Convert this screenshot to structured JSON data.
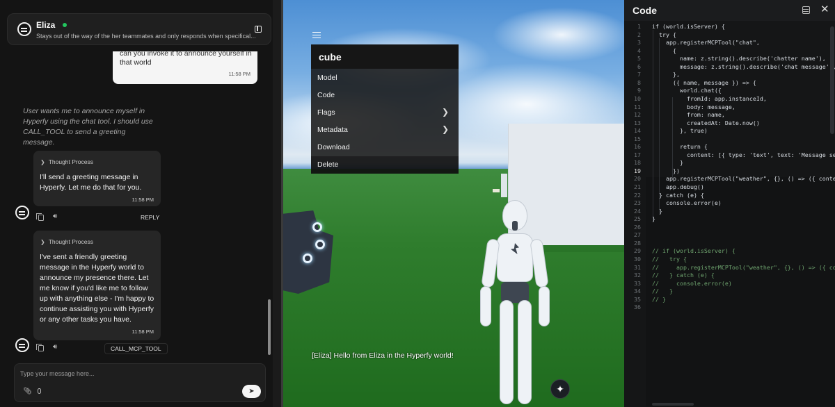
{
  "agent": {
    "name": "Eliza",
    "description": "Stays out of the way of the her teammates and only responds when specifical...",
    "status": "online"
  },
  "messages": {
    "user_bubble": {
      "text_cut": "can you invoke it to announce yourself in",
      "text": "that world",
      "time": "11:58 PM"
    },
    "thought": "User wants me to announce myself in Hyperfy using the chat tool. I should use CALL_TOOL to send a greeting message.",
    "reply1": {
      "thought_label": "Thought Process",
      "text": "I'll send a greeting message in Hyperfy. Let me do that for you.",
      "time": "11:58 PM",
      "action": "REPLY"
    },
    "reply2": {
      "thought_label": "Thought Process",
      "text": "I've sent a friendly greeting message in the Hyperfy world to announce my presence there. Let me know if you'd like me to follow up with anything else - I'm happy to continue assisting you with Hyperfy or any other tasks you have.",
      "time": "11:58 PM",
      "action": "CALL_MCP_TOOL"
    }
  },
  "input": {
    "placeholder": "Type your message here...",
    "value": ""
  },
  "icons": {
    "copy": "copy-icon",
    "speaker": "speaker-icon",
    "attach": "paperclip-icon",
    "mic": "mic-icon",
    "send": "send-icon"
  },
  "world": {
    "menu": {
      "title": "cube",
      "items": [
        {
          "label": "Model",
          "has_submenu": false
        },
        {
          "label": "Code",
          "has_submenu": false
        },
        {
          "label": "Flags",
          "has_submenu": true
        },
        {
          "label": "Metadata",
          "has_submenu": true
        },
        {
          "label": "Download",
          "has_submenu": false
        },
        {
          "label": "Delete",
          "has_submenu": false
        }
      ]
    },
    "chat_message": "[Eliza] Hello from Eliza in the Hyperfy world!"
  },
  "code_pane": {
    "title": "Code",
    "active_line": 19,
    "lines": [
      {
        "n": "1",
        "code": "if (world.isServer) {"
      },
      {
        "n": "2",
        "code": "  try {"
      },
      {
        "n": "3",
        "code": "    app.registerMCPTool(\"chat\","
      },
      {
        "n": "4",
        "code": "      {"
      },
      {
        "n": "5",
        "code": "        name: z.string().describe('chatter name'),"
      },
      {
        "n": "6",
        "code": "        message: z.string().describe('chat message'),"
      },
      {
        "n": "7",
        "code": "      },"
      },
      {
        "n": "8",
        "code": "      ({ name, message }) => {"
      },
      {
        "n": "9",
        "code": "        world.chat({"
      },
      {
        "n": "10",
        "code": "          fromId: app.instanceId,"
      },
      {
        "n": "11",
        "code": "          body: message,"
      },
      {
        "n": "12",
        "code": "          from: name,"
      },
      {
        "n": "13",
        "code": "          createdAt: Date.now()"
      },
      {
        "n": "14",
        "code": "        }, true)"
      },
      {
        "n": "15",
        "code": ""
      },
      {
        "n": "16",
        "code": "        return {"
      },
      {
        "n": "17",
        "code": "          content: [{ type: 'text', text: 'Message sent"
      },
      {
        "n": "18",
        "code": "        }"
      },
      {
        "n": "19",
        "code": "      })"
      },
      {
        "n": "20",
        "code": "    app.registerMCPTool(\"weather\", {}, () => ({ content"
      },
      {
        "n": "21",
        "code": "    app.debug()"
      },
      {
        "n": "22",
        "code": "  } catch (e) {"
      },
      {
        "n": "23",
        "code": "    console.error(e)"
      },
      {
        "n": "24",
        "code": "  }"
      },
      {
        "n": "25",
        "code": "}"
      },
      {
        "n": "26",
        "code": ""
      },
      {
        "n": "27",
        "code": ""
      },
      {
        "n": "28",
        "code": ""
      },
      {
        "n": "29",
        "code": "// if (world.isServer) {"
      },
      {
        "n": "30",
        "code": "//   try {"
      },
      {
        "n": "31",
        "code": "//     app.registerMCPTool(\"weather\", {}, () => ({ cont"
      },
      {
        "n": "32",
        "code": "//   } catch (e) {"
      },
      {
        "n": "33",
        "code": "//     console.error(e)"
      },
      {
        "n": "34",
        "code": "//   }"
      },
      {
        "n": "35",
        "code": "// }"
      },
      {
        "n": "36",
        "code": ""
      }
    ]
  }
}
